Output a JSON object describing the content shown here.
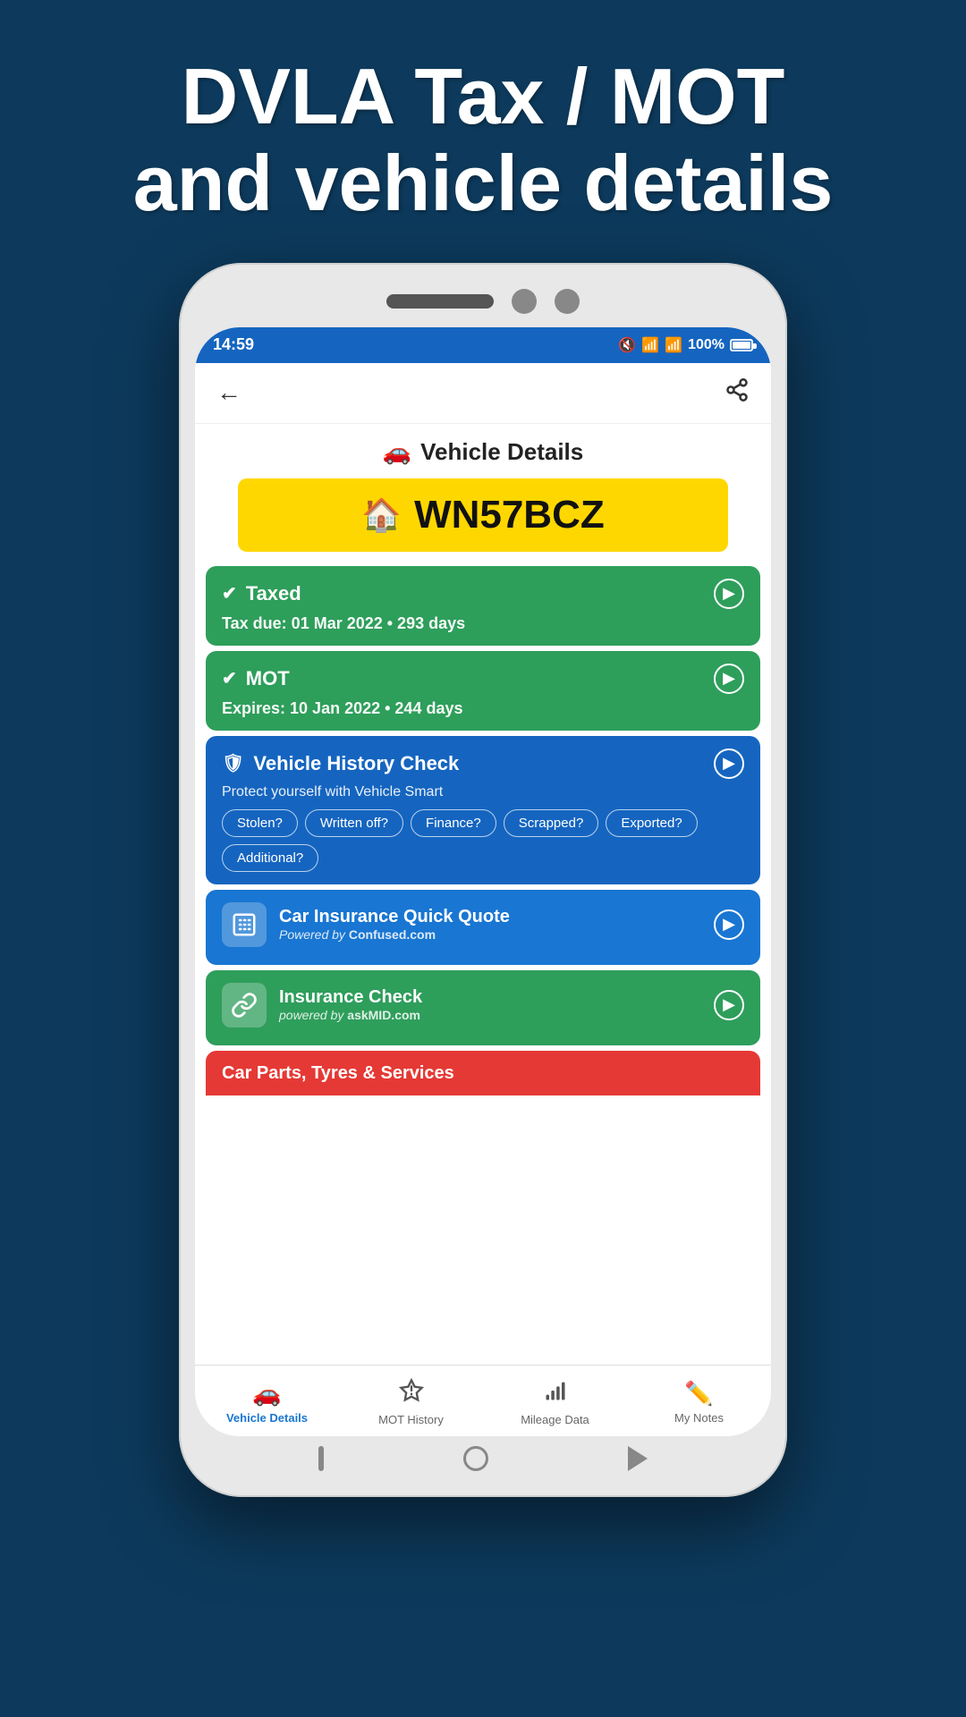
{
  "page": {
    "bg_color": "#0d3a5c",
    "header": {
      "line1": "DVLA Tax / MOT",
      "line2": "and vehicle details"
    }
  },
  "status_bar": {
    "time": "14:59",
    "battery": "100%"
  },
  "app_header": {
    "back_label": "←",
    "share_label": "⋮"
  },
  "vehicle_section": {
    "title": "Vehicle Details",
    "plate": "WN57BCZ"
  },
  "cards": {
    "taxed": {
      "title": "Taxed",
      "subtitle": "Tax due: 01 Mar 2022 • 293 days"
    },
    "mot": {
      "title": "MOT",
      "subtitle": "Expires: 10 Jan 2022 • 244 days"
    },
    "history_check": {
      "title": "Vehicle History Check",
      "description": "Protect yourself with Vehicle Smart",
      "buttons": [
        "Stolen?",
        "Written off?",
        "Finance?",
        "Scrapped?",
        "Exported?",
        "Additional?"
      ]
    },
    "insurance_quote": {
      "title": "Car Insurance Quick Quote",
      "powered_by": "Powered by",
      "brand": "Confused.com"
    },
    "insurance_check": {
      "title": "Insurance Check",
      "powered_by": "powered by",
      "brand": "askMID.com"
    },
    "car_parts": {
      "title": "Car Parts, Tyres & Services"
    }
  },
  "bottom_nav": {
    "items": [
      {
        "label": "Vehicle Details",
        "icon": "🚗",
        "active": true
      },
      {
        "label": "MOT History",
        "icon": "⚠",
        "active": false
      },
      {
        "label": "Mileage Data",
        "icon": "📊",
        "active": false
      },
      {
        "label": "My Notes",
        "icon": "✏",
        "active": false
      }
    ]
  }
}
